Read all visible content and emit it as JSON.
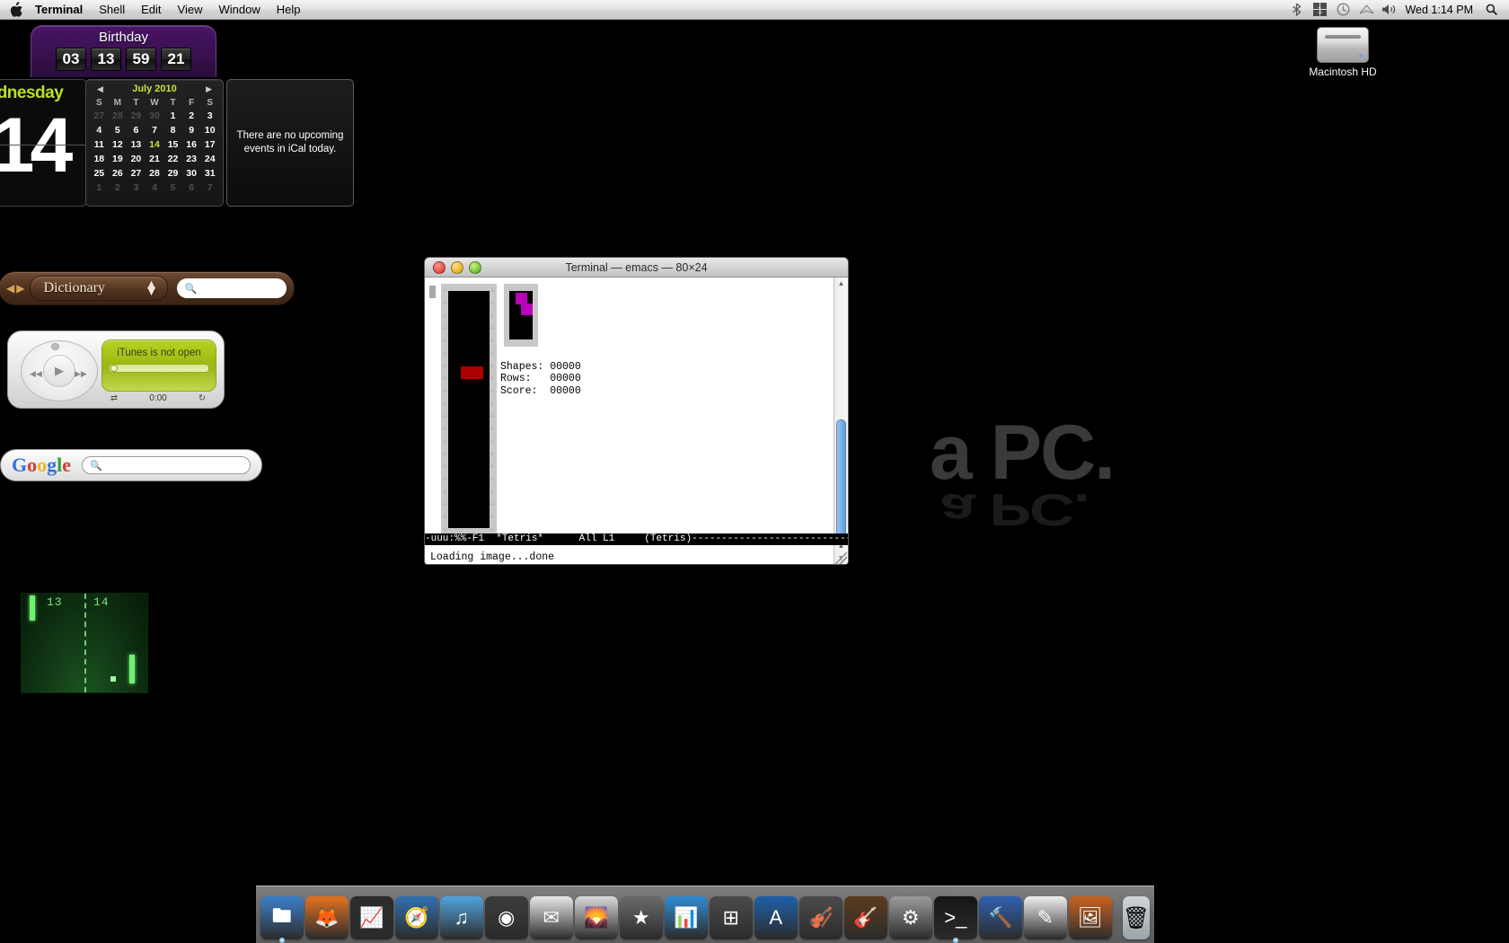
{
  "menubar": {
    "apple_icon": "apple-logo",
    "items": [
      {
        "label": "Terminal",
        "bold": true
      },
      {
        "label": "Shell",
        "bold": false
      },
      {
        "label": "Edit",
        "bold": false
      },
      {
        "label": "View",
        "bold": false
      },
      {
        "label": "Window",
        "bold": false
      },
      {
        "label": "Help",
        "bold": false
      }
    ],
    "status_icons": [
      "bluetooth-icon",
      "input-menu-icon",
      "time-machine-icon",
      "airport-wifi-icon",
      "volume-icon"
    ],
    "clock": "Wed 1:14 PM",
    "spotlight_icon": "search-icon"
  },
  "desktop": {
    "wallpaper_text_line1": "a PC.",
    "wallpaper_text_line2": "a PC.",
    "hd_icon": {
      "label": "Macintosh HD",
      "icon": "hard-disk-icon"
    }
  },
  "widgets": {
    "birthday": {
      "title": "Birthday",
      "digits": [
        "03",
        "13",
        "59",
        "21"
      ]
    },
    "flipdate": {
      "weekday": "dnesday",
      "day": "14"
    },
    "calendar": {
      "month_title": "July 2010",
      "prev_arrow": "◀",
      "next_arrow": "▶",
      "dow": [
        "S",
        "M",
        "T",
        "W",
        "T",
        "F",
        "S"
      ],
      "today": "14",
      "weeks": [
        [
          {
            "d": "27",
            "out": true
          },
          {
            "d": "28",
            "out": true
          },
          {
            "d": "29",
            "out": true
          },
          {
            "d": "30",
            "out": true
          },
          {
            "d": "1",
            "out": false
          },
          {
            "d": "2",
            "out": false
          },
          {
            "d": "3",
            "out": false
          }
        ],
        [
          {
            "d": "4",
            "out": false
          },
          {
            "d": "5",
            "out": false
          },
          {
            "d": "6",
            "out": false
          },
          {
            "d": "7",
            "out": false
          },
          {
            "d": "8",
            "out": false
          },
          {
            "d": "9",
            "out": false
          },
          {
            "d": "10",
            "out": false
          }
        ],
        [
          {
            "d": "11",
            "out": false
          },
          {
            "d": "12",
            "out": false
          },
          {
            "d": "13",
            "out": false
          },
          {
            "d": "14",
            "out": false
          },
          {
            "d": "15",
            "out": false
          },
          {
            "d": "16",
            "out": false
          },
          {
            "d": "17",
            "out": false
          }
        ],
        [
          {
            "d": "18",
            "out": false
          },
          {
            "d": "19",
            "out": false
          },
          {
            "d": "20",
            "out": false
          },
          {
            "d": "21",
            "out": false
          },
          {
            "d": "22",
            "out": false
          },
          {
            "d": "23",
            "out": false
          },
          {
            "d": "24",
            "out": false
          }
        ],
        [
          {
            "d": "25",
            "out": false
          },
          {
            "d": "26",
            "out": false
          },
          {
            "d": "27",
            "out": false
          },
          {
            "d": "28",
            "out": false
          },
          {
            "d": "29",
            "out": false
          },
          {
            "d": "30",
            "out": false
          },
          {
            "d": "31",
            "out": false
          }
        ],
        [
          {
            "d": "1",
            "out": true
          },
          {
            "d": "2",
            "out": true
          },
          {
            "d": "3",
            "out": true
          },
          {
            "d": "4",
            "out": true
          },
          {
            "d": "5",
            "out": true
          },
          {
            "d": "6",
            "out": true
          },
          {
            "d": "7",
            "out": true
          }
        ]
      ]
    },
    "ical": {
      "message": "There are no upcoming events in iCal today."
    },
    "dictionary": {
      "selected": "Dictionary",
      "search_value": "",
      "search_placeholder": "",
      "back_icon": "back-arrow-icon",
      "forward_icon": "forward-arrow-icon",
      "search_icon": "search-icon"
    },
    "itunes": {
      "message": "iTunes is not open",
      "time": "0:00",
      "shuffle_icon": "shuffle-icon",
      "repeat_icon": "repeat-icon",
      "play_icon": "play-icon",
      "prev_icon": "rewind-icon",
      "next_icon": "fast-forward-icon"
    },
    "google": {
      "logo": [
        {
          "c": "G",
          "k": "b"
        },
        {
          "c": "o",
          "k": "r"
        },
        {
          "c": "o",
          "k": "y"
        },
        {
          "c": "g",
          "k": "b"
        },
        {
          "c": "l",
          "k": "g"
        },
        {
          "c": "e",
          "k": "r"
        }
      ],
      "search_value": "",
      "search_placeholder": "",
      "search_icon": "search-icon"
    },
    "pong": {
      "score_left": "13",
      "score_right": "14"
    }
  },
  "terminal": {
    "title": "Terminal — emacs — 80×24",
    "traffic": {
      "close": "close-button",
      "minimize": "minimize-button",
      "zoom": "zoom-button"
    },
    "tetris": {
      "stats": "Shapes: 00000\nRows:   00000\nScore:  00000",
      "shapes_label": "Shapes:",
      "shapes_value": "00000",
      "rows_label": "Rows:",
      "rows_value": "00000",
      "score_label": "Score:",
      "score_value": "00000",
      "current_piece_color": "#aa0000",
      "next_piece_color": "#bb00bb"
    },
    "modeline": "-uuu:%%-F1  *Tetris*      All L1     (Tetris)---------------------------------",
    "modeline_prefix": "-uuu:%%-F1  ",
    "modeline_buffer": "*Tetris*",
    "modeline_pos": "      All L1     (Tetris)",
    "modeline_fill": "---------------------------------",
    "echo": "Loading image...done"
  },
  "dock": {
    "items": [
      {
        "name": "finder",
        "glyph": "🖿",
        "bg": "#3c7fc9",
        "running": true
      },
      {
        "name": "firefox",
        "glyph": "🦊",
        "bg": "#e3721f",
        "running": false
      },
      {
        "name": "activity-monitor",
        "glyph": "📈",
        "bg": "#2b2b2b",
        "running": false
      },
      {
        "name": "safari",
        "glyph": "🧭",
        "bg": "#2f6fb0",
        "running": false
      },
      {
        "name": "itunes",
        "glyph": "♫",
        "bg": "#4fa3dd",
        "running": false
      },
      {
        "name": "dashboard",
        "glyph": "◉",
        "bg": "#3a3a3a",
        "running": false
      },
      {
        "name": "mail",
        "glyph": "✉",
        "bg": "#e8e8e8",
        "running": false
      },
      {
        "name": "iphoto",
        "glyph": "🌄",
        "bg": "#d9d9d9",
        "running": false
      },
      {
        "name": "imovie",
        "glyph": "★",
        "bg": "#6a6a6a",
        "running": false
      },
      {
        "name": "keynote",
        "glyph": "📊",
        "bg": "#2e8bd0",
        "running": false
      },
      {
        "name": "spaces",
        "glyph": "⊞",
        "bg": "#4a4a4a",
        "running": false
      },
      {
        "name": "font-book",
        "glyph": "A",
        "bg": "#1d5fa8",
        "running": false
      },
      {
        "name": "logic",
        "glyph": "🎻",
        "bg": "#4a4a4a",
        "running": false
      },
      {
        "name": "garageband",
        "glyph": "🎸",
        "bg": "#5a3a1a",
        "running": false
      },
      {
        "name": "system-preferences",
        "glyph": "⚙",
        "bg": "#9a9a9a",
        "running": false
      },
      {
        "name": "terminal",
        "glyph": ">_",
        "bg": "#141414",
        "running": true
      },
      {
        "name": "xcode",
        "glyph": "🔨",
        "bg": "#2f5fb0",
        "running": false
      },
      {
        "name": "textedit",
        "glyph": "✎",
        "bg": "#f0f0f0",
        "running": false
      },
      {
        "name": "preview",
        "glyph": "🖼",
        "bg": "#c9621f",
        "running": false
      }
    ],
    "trash": {
      "name": "trash",
      "glyph": "🗑"
    }
  }
}
